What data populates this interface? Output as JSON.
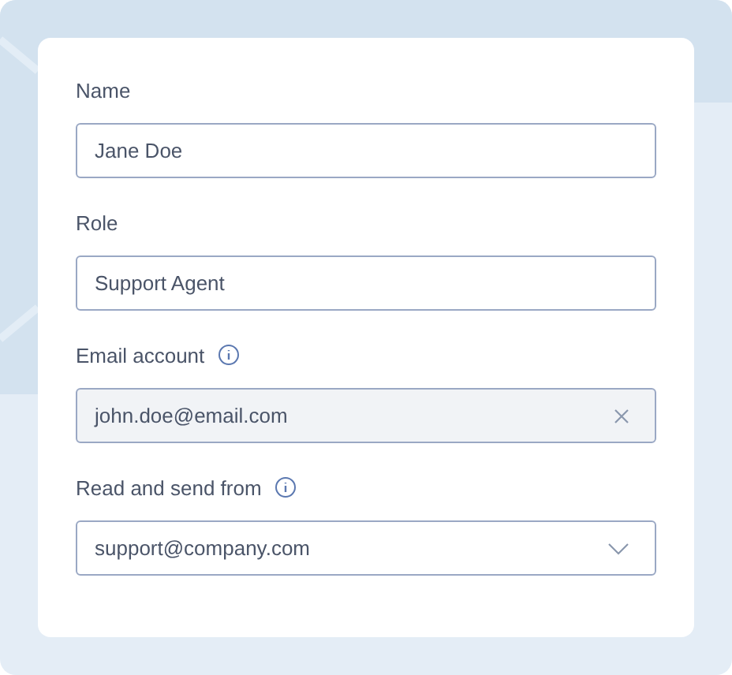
{
  "fields": [
    {
      "label": "Name",
      "info": false,
      "kind": "text",
      "value": "Jane Doe",
      "disabled": false
    },
    {
      "label": "Role",
      "info": false,
      "kind": "text",
      "value": "Support Agent",
      "disabled": false
    },
    {
      "label": "Email account",
      "info": true,
      "kind": "clearable",
      "value": "john.doe@email.com",
      "disabled": true
    },
    {
      "label": "Read and send from",
      "info": true,
      "kind": "select",
      "value": "support@company.com",
      "disabled": false
    }
  ]
}
